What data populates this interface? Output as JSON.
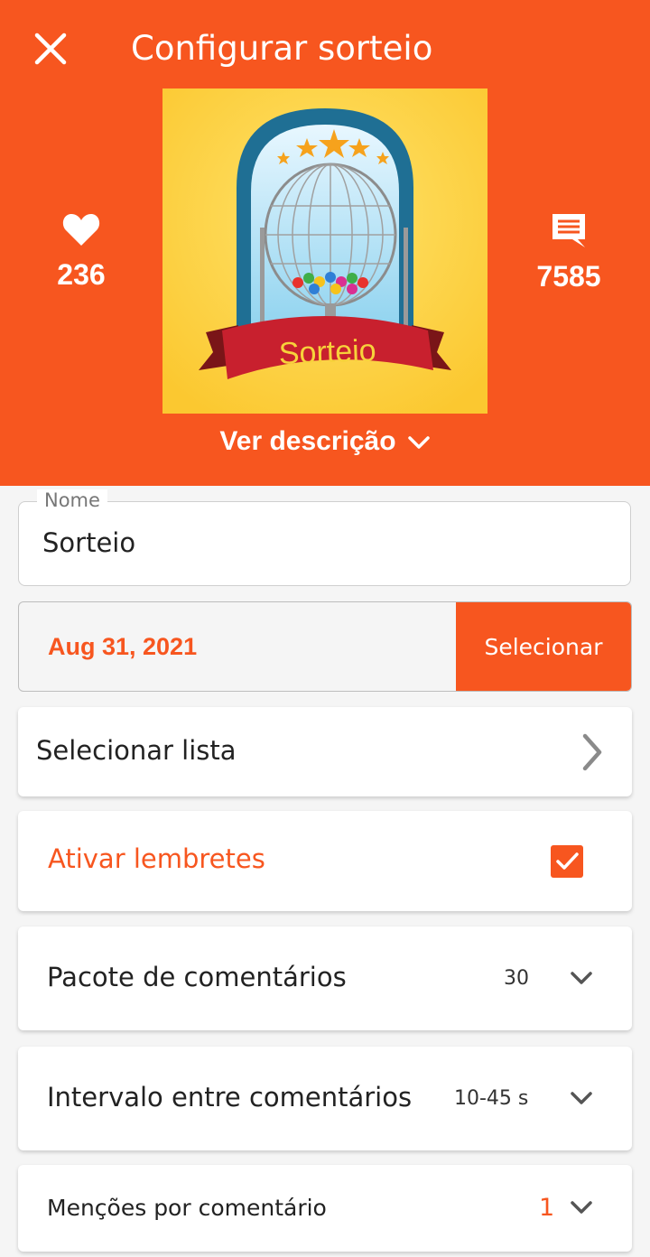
{
  "header": {
    "title": "Configurar sorteio",
    "likes": "236",
    "comments": "7585",
    "cover_text": "Sorteio",
    "description_toggle": "Ver descrição"
  },
  "form": {
    "name_label": "Nome",
    "name_value": "Sorteio",
    "date_value": "Aug 31, 2021",
    "date_button": "Selecionar",
    "list_label": "Selecionar lista",
    "reminders_label": "Ativar lembretes",
    "reminders_checked": true,
    "pack_label": "Pacote de comentários",
    "pack_value": "30",
    "interval_label": "Intervalo entre comentários",
    "interval_value": "10-45 s",
    "mentions_label": "Menções por comentário",
    "mentions_value": "1"
  },
  "colors": {
    "accent": "#f7561f",
    "background": "#f5f5f5"
  },
  "icons": {
    "close": "close-icon",
    "likes": "heart-icon",
    "comments": "comment-icon",
    "expand": "chevron-down-icon",
    "navigate": "chevron-right-icon",
    "check": "checkmark-icon"
  }
}
